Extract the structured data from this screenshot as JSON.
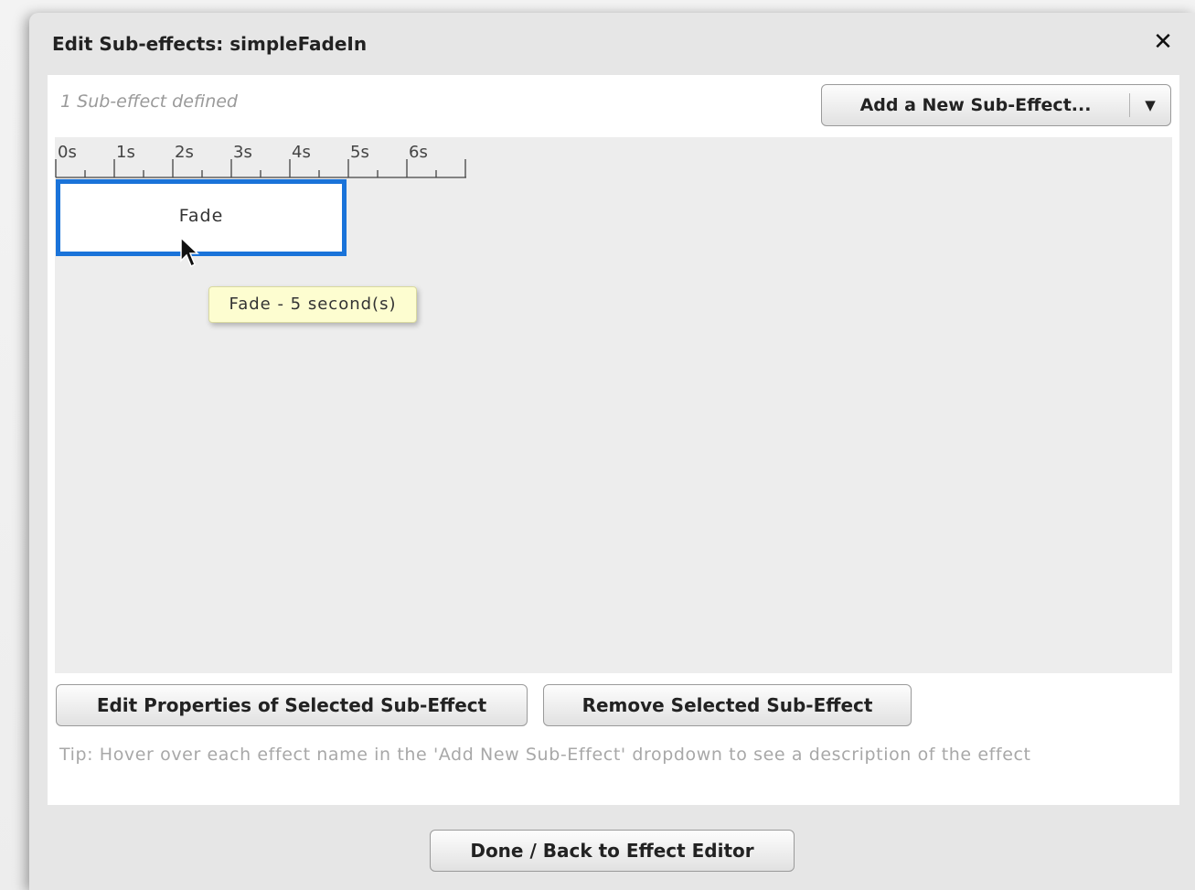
{
  "dialog": {
    "title": "Edit Sub-effects: simpleFadeIn",
    "close_icon": "close-icon"
  },
  "panel": {
    "count_text": "1 Sub-effect defined",
    "add_button_label": "Add a New Sub-Effect...",
    "add_button_icon": "chevron-down-icon"
  },
  "timeline": {
    "ruler_labels": [
      "0s",
      "1s",
      "2s",
      "3s",
      "4s",
      "5s",
      "6s"
    ],
    "effects": [
      {
        "name": "Fade",
        "duration_seconds": 5,
        "selected": true
      }
    ],
    "tooltip": "Fade - 5 second(s)",
    "selection_color": "#1a73d9"
  },
  "actions": {
    "edit_label": "Edit Properties of Selected Sub-Effect",
    "remove_label": "Remove Selected Sub-Effect",
    "tip": "Tip: Hover over each effect name in the 'Add New Sub-Effect' dropdown to see a description of the effect",
    "done_label": "Done / Back to Effect Editor"
  }
}
